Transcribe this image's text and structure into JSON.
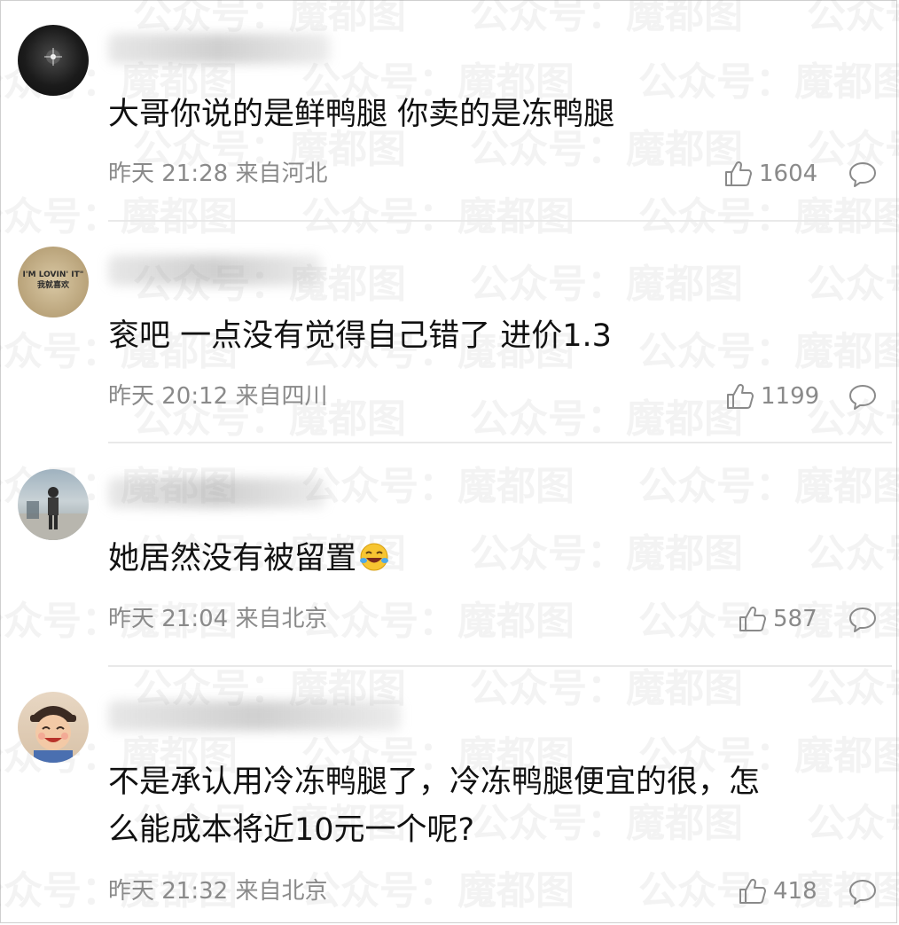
{
  "comments": [
    {
      "text": "大哥你说的是鲜鸭腿 你卖的是冻鸭腿",
      "time": "昨天 21:28",
      "location": "来自河北",
      "likes": "1604"
    },
    {
      "text": "衮吧 一点没有觉得自己错了 进价1.3",
      "time": "昨天 20:12",
      "location": "来自四川",
      "likes": "1199",
      "avatar_text_line1": "I'M LOVIN' IT\"",
      "avatar_text_line2": "我就喜欢"
    },
    {
      "text": "她居然没有被留置",
      "time": "昨天 21:04",
      "location": "来自北京",
      "likes": "587"
    },
    {
      "text_line1": "不是承认用冷冻鸭腿了，冷冻鸭腿便宜的很，怎",
      "text_line2": "么能成本将近10元一个呢?",
      "time": "昨天 21:32",
      "location": "来自北京",
      "likes": "418"
    }
  ],
  "watermark": {
    "text": "公众号：魔都图"
  },
  "colors": {
    "meta": "#8a8a8a",
    "text": "#111111",
    "divider": "#e9e9e9"
  },
  "icons": {
    "like": "thumbs-up-icon",
    "reply": "comment-bubble-icon",
    "emoji": "laughing-tears-emoji"
  }
}
